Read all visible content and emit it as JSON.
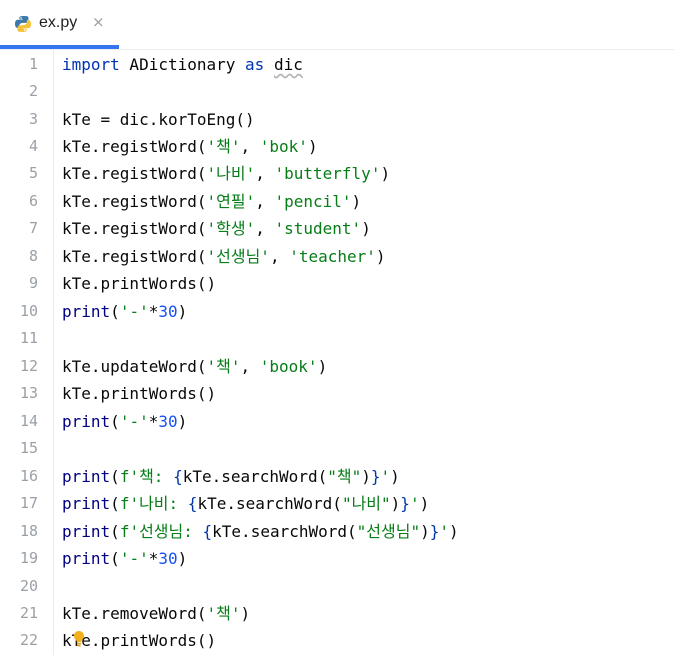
{
  "tab": {
    "label": "ex.py",
    "close": "×",
    "icon": "python-file-icon"
  },
  "line_numbers": [
    "1",
    "2",
    "3",
    "4",
    "5",
    "6",
    "7",
    "8",
    "9",
    "10",
    "11",
    "12",
    "13",
    "14",
    "15",
    "16",
    "17",
    "18",
    "19",
    "20",
    "21",
    "22"
  ],
  "code": {
    "l1": {
      "kw_import": "import",
      "module": " ADictionary ",
      "kw_as": "as",
      "sp": " ",
      "alias": "dic"
    },
    "l3": {
      "text": "kTe = dic.korToEng()"
    },
    "l4": {
      "pre": "kTe.registWord(",
      "s1": "'책'",
      "mid": ", ",
      "s2": "'bok'",
      "post": ")"
    },
    "l5": {
      "pre": "kTe.registWord(",
      "s1": "'나비'",
      "mid": ", ",
      "s2": "'butterfly'",
      "post": ")"
    },
    "l6": {
      "pre": "kTe.registWord(",
      "s1": "'연필'",
      "mid": ", ",
      "s2": "'pencil'",
      "post": ")"
    },
    "l7": {
      "pre": "kTe.registWord(",
      "s1": "'학생'",
      "mid": ", ",
      "s2": "'student'",
      "post": ")"
    },
    "l8": {
      "pre": "kTe.registWord(",
      "s1": "'선생님'",
      "mid": ", ",
      "s2": "'teacher'",
      "post": ")"
    },
    "l9": {
      "text": "kTe.printWords()"
    },
    "l10": {
      "fn": "print",
      "open": "(",
      "s": "'-'",
      "op": "*",
      "num": "30",
      "close": ")"
    },
    "l12": {
      "pre": "kTe.updateWord(",
      "s1": "'책'",
      "mid": ", ",
      "s2": "'book'",
      "post": ")"
    },
    "l13": {
      "text": "kTe.printWords()"
    },
    "l14": {
      "fn": "print",
      "open": "(",
      "s": "'-'",
      "op": "*",
      "num": "30",
      "close": ")"
    },
    "l16": {
      "fn": "print",
      "open": "(",
      "f1": "f'책: ",
      "b1": "{",
      "expr_pre": "kTe.searchWord(",
      "arg": "\"책\"",
      "expr_post": ")",
      "b2": "}",
      "f2": "'",
      "close": ")"
    },
    "l17": {
      "fn": "print",
      "open": "(",
      "f1": "f'나비: ",
      "b1": "{",
      "expr_pre": "kTe.searchWord(",
      "arg": "\"나비\"",
      "expr_post": ")",
      "b2": "}",
      "f2": "'",
      "close": ")"
    },
    "l18": {
      "fn": "print",
      "open": "(",
      "f1": "f'선생님: ",
      "b1": "{",
      "expr_pre": "kTe.searchWord(",
      "arg": "\"선생님\"",
      "expr_post": ")",
      "b2": "}",
      "f2": "'",
      "close": ")"
    },
    "l19": {
      "fn": "print",
      "open": "(",
      "s": "'-'",
      "op": "*",
      "num": "30",
      "close": ")"
    },
    "l21": {
      "pre": "kTe.removeWord(",
      "s1": "'책'",
      "post": ")"
    },
    "l22": {
      "text": "kTe.printWords()"
    }
  },
  "colors": {
    "keyword": "#0033b3",
    "string": "#067d17",
    "number": "#1750eb",
    "builtin": "#000080",
    "accent": "#3574f0"
  },
  "icons": {
    "intention": "lightbulb-icon"
  }
}
